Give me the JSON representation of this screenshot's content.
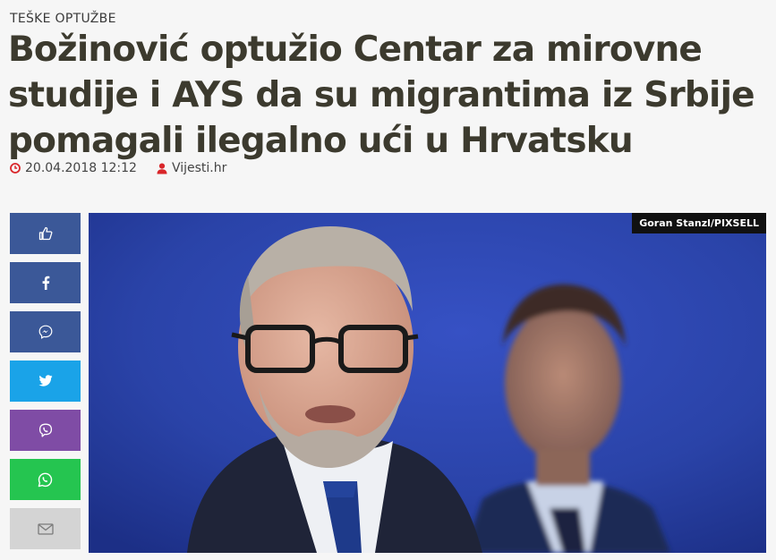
{
  "article": {
    "category": "TEŠKE OPTUŽBE",
    "title": "Božinović optužio Centar za mirovne studije i AYS da su migrantima iz Srbije pomagali ilegalno ući u Hrvatsku",
    "datetime": "20.04.2018 12:12",
    "source": "Vijesti.hr"
  },
  "photo": {
    "credit": "Goran Stanzl/PIXSELL"
  },
  "share": {
    "buttons": [
      {
        "name": "like",
        "icon": "thumbs-up-icon",
        "color": "#3b5898"
      },
      {
        "name": "facebook",
        "icon": "facebook-icon",
        "color": "#3b5898"
      },
      {
        "name": "messenger",
        "icon": "messenger-icon",
        "color": "#3b5898"
      },
      {
        "name": "twitter",
        "icon": "twitter-icon",
        "color": "#1aa3e8"
      },
      {
        "name": "viber",
        "icon": "viber-icon",
        "color": "#7f4ca5"
      },
      {
        "name": "whatsapp",
        "icon": "whatsapp-icon",
        "color": "#25c550"
      },
      {
        "name": "email",
        "icon": "envelope-icon",
        "color": "#d4d4d4"
      }
    ]
  },
  "colors": {
    "meta_icon": "#d9262a",
    "headline": "#3c3a2e"
  }
}
